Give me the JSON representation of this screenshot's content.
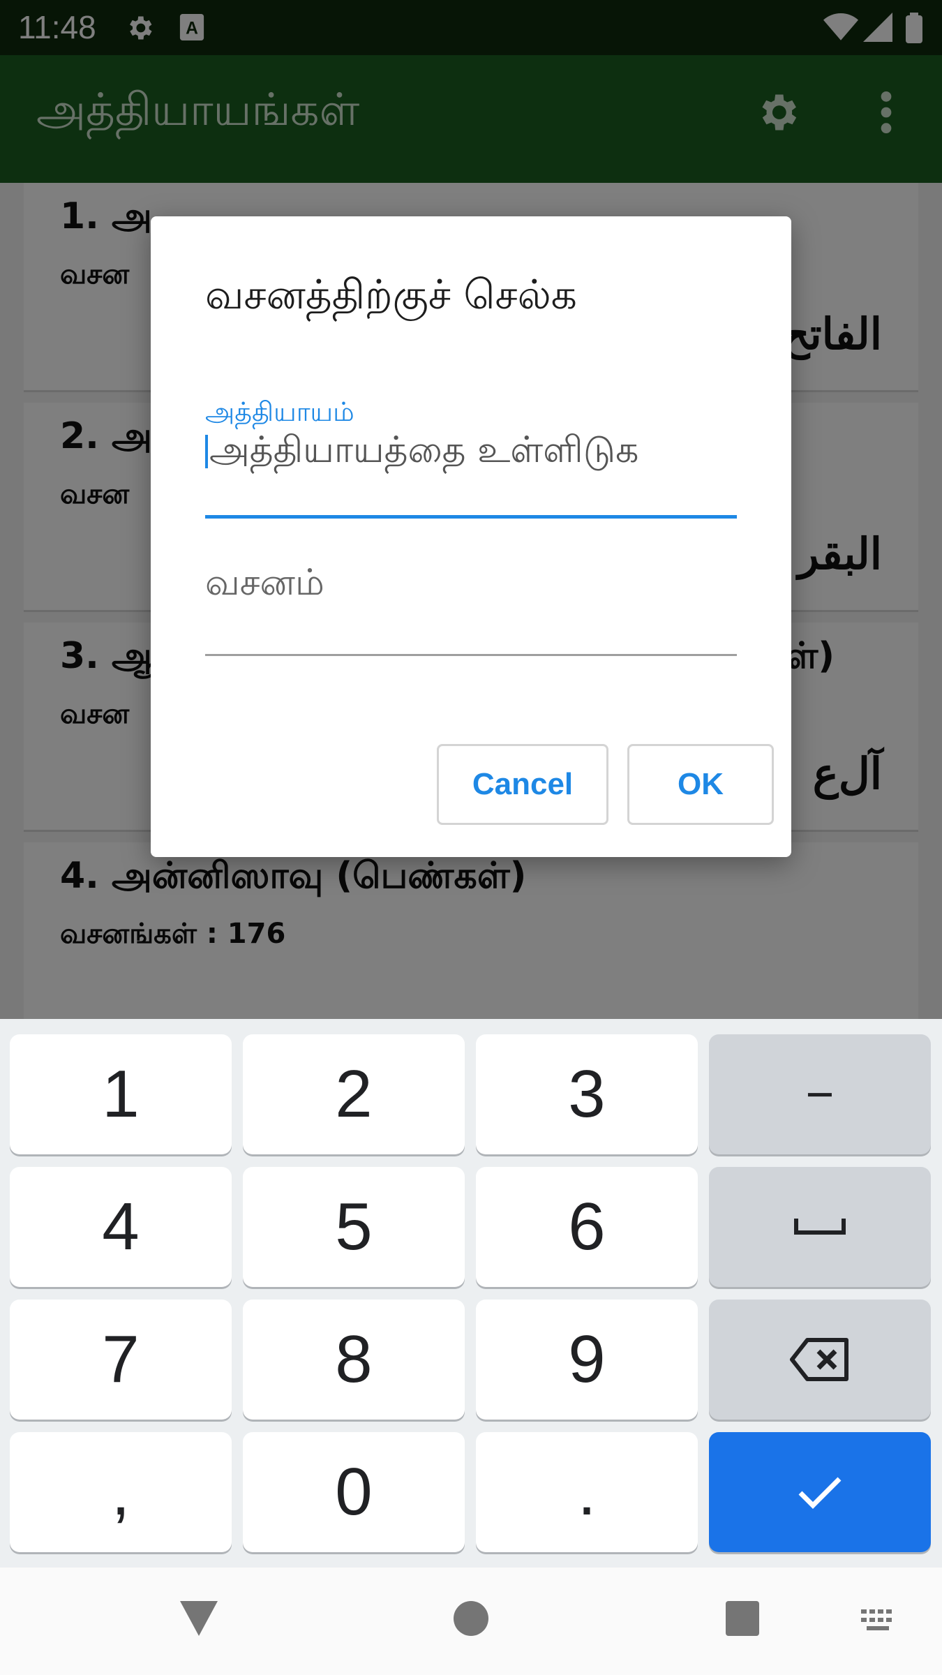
{
  "status_bar": {
    "time": "11:48",
    "icons": [
      "gear-icon",
      "text-a-icon",
      "wifi-icon",
      "signal-icon",
      "battery-icon"
    ]
  },
  "app_bar": {
    "title": "அத்தியாயங்கள்",
    "actions": [
      "settings-icon",
      "more-vert-icon"
    ]
  },
  "chapters": [
    {
      "title": "1. அ",
      "verses": "வசன",
      "arabic": "الفاتح"
    },
    {
      "title": "2. அ",
      "verses": "வசன",
      "arabic": "البقر"
    },
    {
      "title": "3. ஆ",
      "title_suffix": "ள்)",
      "verses": "வசன",
      "arabic": "آل‌ع"
    },
    {
      "title": "4. அன்னிஸாவு (பெண்கள்)",
      "verses": "வசனங்கள் : 176"
    }
  ],
  "dialog": {
    "title": "வசனத்திற்குச் செல்க",
    "chapter_field": {
      "label": "அத்தியாயம்",
      "placeholder": "அத்தியாயத்தை உள்ளிடுக",
      "value": ""
    },
    "verse_field": {
      "placeholder": "வசனம்",
      "value": ""
    },
    "cancel_label": "Cancel",
    "ok_label": "OK"
  },
  "keyboard": {
    "keys": [
      "1",
      "2",
      "3",
      "−",
      "4",
      "5",
      "6",
      "␣",
      "7",
      "8",
      "9",
      "⌫",
      ",",
      "0",
      ".",
      "✓"
    ]
  },
  "nav_bar": {
    "icons": [
      "back-icon",
      "home-icon",
      "recents-icon",
      "keyboard-icon"
    ]
  },
  "colors": {
    "status_bar": "#0f2a0d",
    "app_bar": "#1b5e20",
    "accent": "#1e88e5",
    "enter_key": "#1a73e8"
  }
}
